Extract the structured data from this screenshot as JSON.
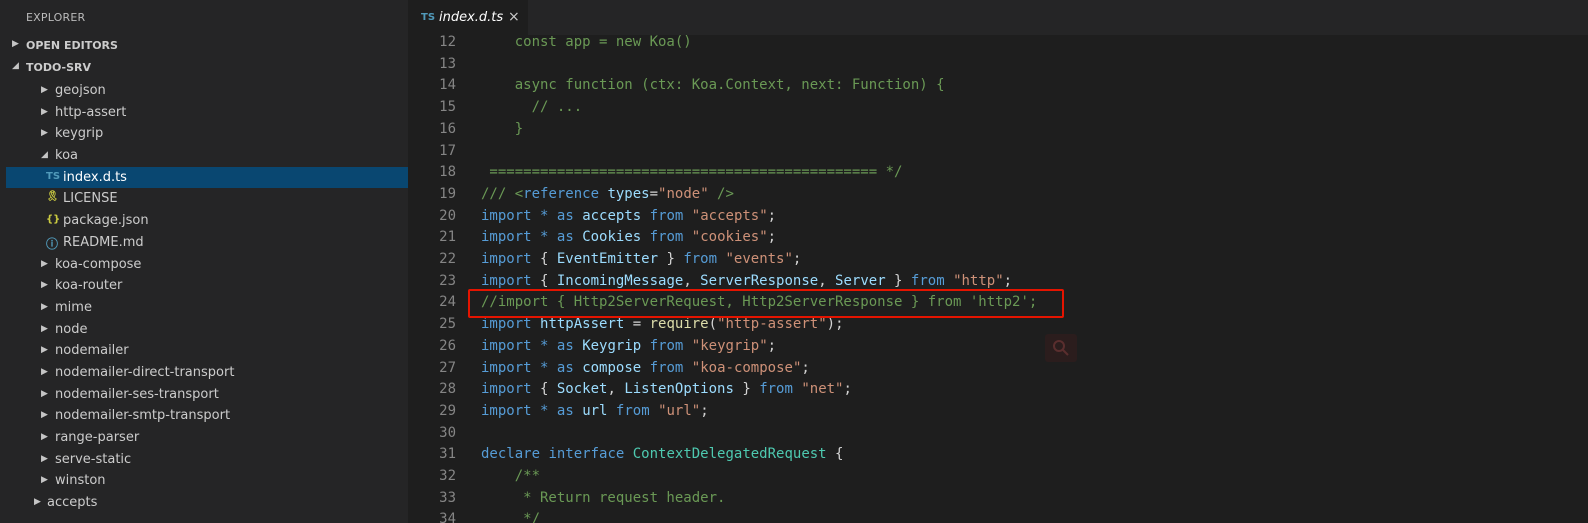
{
  "explorer": {
    "title": "EXPLORER",
    "sections": [
      {
        "label": "OPEN EDITORS",
        "expanded": false
      },
      {
        "label": "TODO-SRV",
        "expanded": true
      }
    ],
    "tree": [
      {
        "label": "geojson",
        "type": "folder"
      },
      {
        "label": "http-assert",
        "type": "folder"
      },
      {
        "label": "keygrip",
        "type": "folder"
      },
      {
        "label": "koa",
        "type": "folder-open"
      },
      {
        "label": "index.d.ts",
        "type": "ts-file",
        "selected": true
      },
      {
        "label": "LICENSE",
        "type": "license-file"
      },
      {
        "label": "package.json",
        "type": "json-file"
      },
      {
        "label": "README.md",
        "type": "info-file"
      },
      {
        "label": "koa-compose",
        "type": "folder"
      },
      {
        "label": "koa-router",
        "type": "folder"
      },
      {
        "label": "mime",
        "type": "folder"
      },
      {
        "label": "node",
        "type": "folder"
      },
      {
        "label": "nodemailer",
        "type": "folder"
      },
      {
        "label": "nodemailer-direct-transport",
        "type": "folder"
      },
      {
        "label": "nodemailer-ses-transport",
        "type": "folder"
      },
      {
        "label": "nodemailer-smtp-transport",
        "type": "folder"
      },
      {
        "label": "range-parser",
        "type": "folder"
      },
      {
        "label": "serve-static",
        "type": "folder"
      },
      {
        "label": "winston",
        "type": "folder"
      },
      {
        "label": "accepts",
        "type": "folder-top"
      }
    ]
  },
  "tab": {
    "icon": "TS",
    "name": "index.d.ts",
    "close": "×"
  },
  "editor": {
    "highlight_line": 24,
    "lines": [
      {
        "n": "12",
        "tokens": [
          [
            "c-cm",
            "    const app = new Koa()"
          ]
        ]
      },
      {
        "n": "13",
        "tokens": []
      },
      {
        "n": "14",
        "tokens": [
          [
            "c-cm",
            "    async function (ctx: Koa.Context, next: Function) {"
          ]
        ]
      },
      {
        "n": "15",
        "tokens": [
          [
            "c-cm",
            "      // ..."
          ]
        ]
      },
      {
        "n": "16",
        "tokens": [
          [
            "c-cm",
            "    }"
          ]
        ]
      },
      {
        "n": "17",
        "tokens": []
      },
      {
        "n": "18",
        "tokens": [
          [
            "c-cm",
            " ============================================== */"
          ]
        ]
      },
      {
        "n": "19",
        "tokens": [
          [
            "c-cm",
            "/// <"
          ],
          [
            "c-kw",
            "reference"
          ],
          [
            "c-pl",
            " "
          ],
          [
            "c-var",
            "types"
          ],
          [
            "c-pl",
            "="
          ],
          [
            "c-str",
            "\"node\""
          ],
          [
            "c-cm",
            " />"
          ]
        ]
      },
      {
        "n": "20",
        "tokens": [
          [
            "c-kw",
            "import"
          ],
          [
            "c-pl",
            " "
          ],
          [
            "c-kw",
            "*"
          ],
          [
            "c-pl",
            " "
          ],
          [
            "c-kw",
            "as"
          ],
          [
            "c-pl",
            " "
          ],
          [
            "c-var",
            "accepts"
          ],
          [
            "c-pl",
            " "
          ],
          [
            "c-kw",
            "from"
          ],
          [
            "c-pl",
            " "
          ],
          [
            "c-str",
            "\"accepts\""
          ],
          [
            "c-pl",
            ";"
          ]
        ]
      },
      {
        "n": "21",
        "tokens": [
          [
            "c-kw",
            "import"
          ],
          [
            "c-pl",
            " "
          ],
          [
            "c-kw",
            "*"
          ],
          [
            "c-pl",
            " "
          ],
          [
            "c-kw",
            "as"
          ],
          [
            "c-pl",
            " "
          ],
          [
            "c-var",
            "Cookies"
          ],
          [
            "c-pl",
            " "
          ],
          [
            "c-kw",
            "from"
          ],
          [
            "c-pl",
            " "
          ],
          [
            "c-str",
            "\"cookies\""
          ],
          [
            "c-pl",
            ";"
          ]
        ]
      },
      {
        "n": "22",
        "tokens": [
          [
            "c-kw",
            "import"
          ],
          [
            "c-pl",
            " { "
          ],
          [
            "c-var",
            "EventEmitter"
          ],
          [
            "c-pl",
            " } "
          ],
          [
            "c-kw",
            "from"
          ],
          [
            "c-pl",
            " "
          ],
          [
            "c-str",
            "\"events\""
          ],
          [
            "c-pl",
            ";"
          ]
        ]
      },
      {
        "n": "23",
        "tokens": [
          [
            "c-kw",
            "import"
          ],
          [
            "c-pl",
            " { "
          ],
          [
            "c-var",
            "IncomingMessage"
          ],
          [
            "c-pl",
            ", "
          ],
          [
            "c-var",
            "ServerResponse"
          ],
          [
            "c-pl",
            ", "
          ],
          [
            "c-var",
            "Server"
          ],
          [
            "c-pl",
            " } "
          ],
          [
            "c-kw",
            "from"
          ],
          [
            "c-pl",
            " "
          ],
          [
            "c-str",
            "\"http\""
          ],
          [
            "c-pl",
            ";"
          ]
        ]
      },
      {
        "n": "24",
        "tokens": [
          [
            "c-cm",
            "//import { Http2ServerRequest, Http2ServerResponse } from 'http2';"
          ]
        ]
      },
      {
        "n": "25",
        "tokens": [
          [
            "c-kw",
            "import"
          ],
          [
            "c-pl",
            " "
          ],
          [
            "c-var",
            "httpAssert"
          ],
          [
            "c-pl",
            " = "
          ],
          [
            "c-fn",
            "require"
          ],
          [
            "c-pl",
            "("
          ],
          [
            "c-str",
            "\"http-assert\""
          ],
          [
            "c-pl",
            ");"
          ]
        ]
      },
      {
        "n": "26",
        "tokens": [
          [
            "c-kw",
            "import"
          ],
          [
            "c-pl",
            " "
          ],
          [
            "c-kw",
            "*"
          ],
          [
            "c-pl",
            " "
          ],
          [
            "c-kw",
            "as"
          ],
          [
            "c-pl",
            " "
          ],
          [
            "c-var",
            "Keygrip"
          ],
          [
            "c-pl",
            " "
          ],
          [
            "c-kw",
            "from"
          ],
          [
            "c-pl",
            " "
          ],
          [
            "c-str",
            "\"keygrip\""
          ],
          [
            "c-pl",
            ";"
          ]
        ]
      },
      {
        "n": "27",
        "tokens": [
          [
            "c-kw",
            "import"
          ],
          [
            "c-pl",
            " "
          ],
          [
            "c-kw",
            "*"
          ],
          [
            "c-pl",
            " "
          ],
          [
            "c-kw",
            "as"
          ],
          [
            "c-pl",
            " "
          ],
          [
            "c-var",
            "compose"
          ],
          [
            "c-pl",
            " "
          ],
          [
            "c-kw",
            "from"
          ],
          [
            "c-pl",
            " "
          ],
          [
            "c-str",
            "\"koa-compose\""
          ],
          [
            "c-pl",
            ";"
          ]
        ]
      },
      {
        "n": "28",
        "tokens": [
          [
            "c-kw",
            "import"
          ],
          [
            "c-pl",
            " { "
          ],
          [
            "c-var",
            "Socket"
          ],
          [
            "c-pl",
            ", "
          ],
          [
            "c-var",
            "ListenOptions"
          ],
          [
            "c-pl",
            " } "
          ],
          [
            "c-kw",
            "from"
          ],
          [
            "c-pl",
            " "
          ],
          [
            "c-str",
            "\"net\""
          ],
          [
            "c-pl",
            ";"
          ]
        ]
      },
      {
        "n": "29",
        "tokens": [
          [
            "c-kw",
            "import"
          ],
          [
            "c-pl",
            " "
          ],
          [
            "c-kw",
            "*"
          ],
          [
            "c-pl",
            " "
          ],
          [
            "c-kw",
            "as"
          ],
          [
            "c-pl",
            " "
          ],
          [
            "c-var",
            "url"
          ],
          [
            "c-pl",
            " "
          ],
          [
            "c-kw",
            "from"
          ],
          [
            "c-pl",
            " "
          ],
          [
            "c-str",
            "\"url\""
          ],
          [
            "c-pl",
            ";"
          ]
        ]
      },
      {
        "n": "30",
        "tokens": []
      },
      {
        "n": "31",
        "tokens": [
          [
            "c-kw",
            "declare"
          ],
          [
            "c-pl",
            " "
          ],
          [
            "c-kw",
            "interface"
          ],
          [
            "c-pl",
            " "
          ],
          [
            "c-type",
            "ContextDelegatedRequest"
          ],
          [
            "c-pl",
            " {"
          ]
        ]
      },
      {
        "n": "32",
        "tokens": [
          [
            "c-cm",
            "    /**"
          ]
        ]
      },
      {
        "n": "33",
        "tokens": [
          [
            "c-cm",
            "     * Return request header."
          ]
        ]
      },
      {
        "n": "34",
        "tokens": [
          [
            "c-cm",
            "     */"
          ]
        ]
      }
    ]
  },
  "colors": {
    "accent": "#094771",
    "highlight_box": "#e51400",
    "ts_icon": "#519aba"
  }
}
